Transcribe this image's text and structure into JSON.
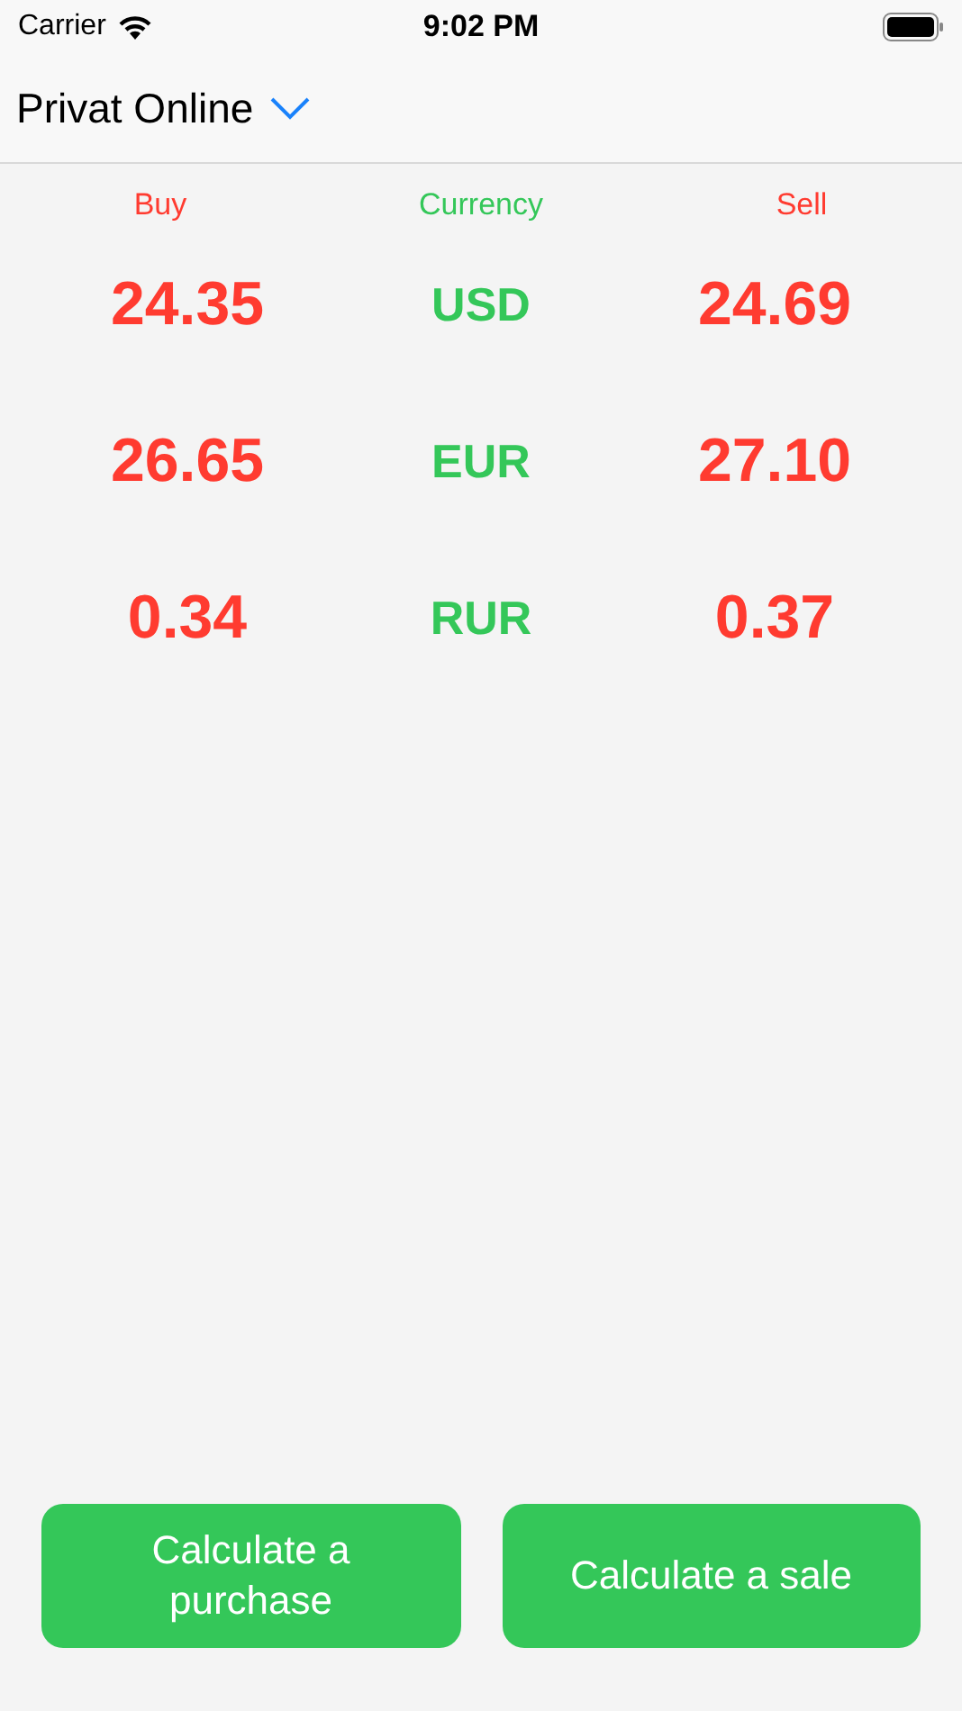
{
  "status_bar": {
    "carrier": "Carrier",
    "time": "9:02 PM"
  },
  "nav": {
    "title": "Privat Online"
  },
  "table": {
    "columns": [
      "Buy",
      "Currency",
      "Sell"
    ],
    "rows": [
      {
        "buy": "24.35",
        "currency": "USD",
        "sell": "24.69"
      },
      {
        "buy": "26.65",
        "currency": "EUR",
        "sell": "27.10"
      },
      {
        "buy": "0.34",
        "currency": "RUR",
        "sell": "0.37"
      }
    ]
  },
  "buttons": [
    "Calculate a purchase",
    "Calculate a sale"
  ]
}
